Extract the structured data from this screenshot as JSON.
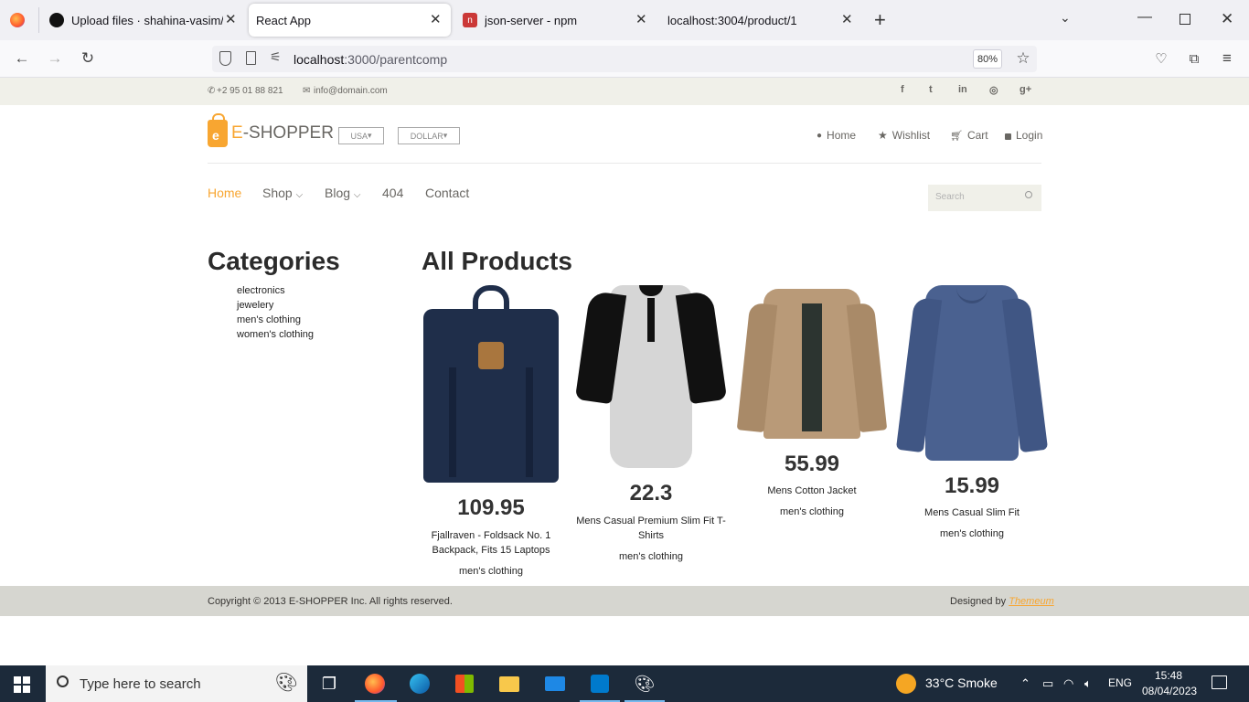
{
  "browser": {
    "tabs": [
      {
        "title": "Upload files · shahina-vasim/Re",
        "favicon": "github-icon",
        "active": false
      },
      {
        "title": "React App",
        "favicon": "none",
        "active": true
      },
      {
        "title": "json-server - npm",
        "favicon": "npm-icon",
        "active": false
      },
      {
        "title": "localhost:3004/product/1",
        "favicon": "none",
        "active": false
      }
    ],
    "new_tab": "+",
    "url_host": "localhost",
    "url_path": ":3000/parentcomp",
    "zoom": "80%"
  },
  "topbar": {
    "phone": "+2 95 01 88 821",
    "email": "info@domain.com",
    "social": [
      "f",
      "t",
      "in",
      "◎",
      "g+"
    ]
  },
  "header": {
    "logo_e": "e",
    "logo_brand_e": "E",
    "logo_text": "-SHOPPER",
    "country": "USA",
    "currency": "DOLLAR",
    "links": [
      {
        "icon": "user-icon",
        "label": "Home"
      },
      {
        "icon": "star-icon",
        "label": "Wishlist"
      },
      {
        "icon": "cart-icon",
        "label": "Cart"
      },
      {
        "icon": "lock-icon",
        "label": "Login"
      }
    ]
  },
  "menu": {
    "items": [
      "Home",
      "Shop",
      "Blog",
      "404",
      "Contact"
    ],
    "active": "Home",
    "search_placeholder": "Search"
  },
  "categories": {
    "title": "Categories",
    "items": [
      "electronics",
      "jewelery",
      "men's clothing",
      "women's clothing"
    ]
  },
  "products": {
    "title": "All Products",
    "items": [
      {
        "price": "109.95",
        "name": "Fjallraven - Foldsack No. 1 Backpack, Fits 15 Laptops",
        "category": "men's clothing",
        "color": "#1f2e4a"
      },
      {
        "price": "22.3",
        "name": "Mens Casual Premium Slim Fit T-Shirts",
        "category": "men's clothing",
        "color": "#d0d0d0"
      },
      {
        "price": "55.99",
        "name": "Mens Cotton Jacket",
        "category": "men's clothing",
        "color": "#b99a78"
      },
      {
        "price": "15.99",
        "name": "Mens Casual Slim Fit",
        "category": "men's clothing",
        "color": "#4a6190"
      }
    ]
  },
  "footer": {
    "copyright": "Copyright © 2013 E-SHOPPER Inc. All rights reserved.",
    "designed_by": "Designed by",
    "designer": "Themeum"
  },
  "taskbar": {
    "search_placeholder": "Type here to search",
    "weather": "33°C  Smoke",
    "lang": "ENG",
    "time": "15:48",
    "date": "08/04/2023"
  },
  "colors": {
    "accent": "#f8a631",
    "text": "#696763",
    "footer_bg": "#d6d6d0"
  }
}
